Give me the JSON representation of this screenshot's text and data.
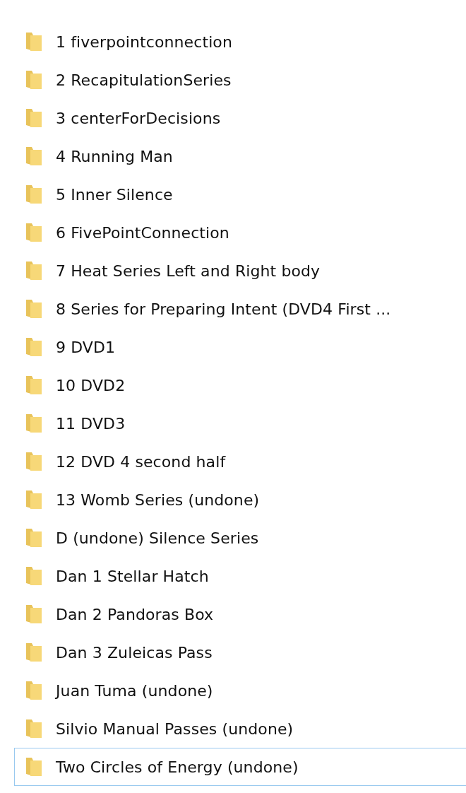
{
  "folders": [
    {
      "name": "1 fiverpointconnection",
      "focused": false
    },
    {
      "name": "2 RecapitulationSeries",
      "focused": false
    },
    {
      "name": "3 centerForDecisions",
      "focused": false
    },
    {
      "name": "4 Running Man",
      "focused": false
    },
    {
      "name": "5 Inner Silence",
      "focused": false
    },
    {
      "name": "6 FivePointConnection",
      "focused": false
    },
    {
      "name": "7 Heat Series Left and Right body",
      "focused": false
    },
    {
      "name": "8 Series for Preparing Intent (DVD4 First ...",
      "focused": false
    },
    {
      "name": "9 DVD1",
      "focused": false
    },
    {
      "name": "10 DVD2",
      "focused": false
    },
    {
      "name": "11 DVD3",
      "focused": false
    },
    {
      "name": "12 DVD 4 second half",
      "focused": false
    },
    {
      "name": "13 Womb Series (undone)",
      "focused": false
    },
    {
      "name": "D (undone) Silence Series",
      "focused": false
    },
    {
      "name": "Dan 1 Stellar Hatch",
      "focused": false
    },
    {
      "name": "Dan 2 Pandoras Box",
      "focused": false
    },
    {
      "name": "Dan 3 Zuleicas Pass",
      "focused": false
    },
    {
      "name": "Juan Tuma (undone)",
      "focused": false
    },
    {
      "name": "Silvio Manual Passes (undone)",
      "focused": false
    },
    {
      "name": "Two Circles of Energy (undone)",
      "focused": true
    }
  ]
}
